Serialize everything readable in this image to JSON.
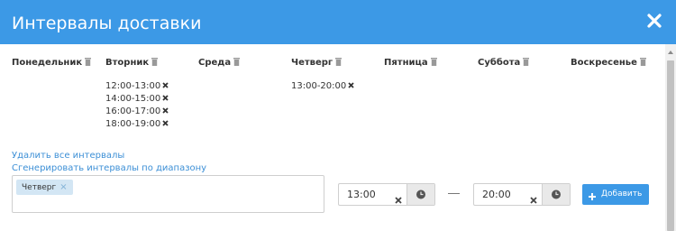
{
  "dialog": {
    "title": "Интервалы доставки",
    "close_icon": "close-icon"
  },
  "days": [
    {
      "name": "Понедельник",
      "slots": []
    },
    {
      "name": "Вторник",
      "slots": [
        "12:00-13:00",
        "14:00-15:00",
        "16:00-17:00",
        "18:00-19:00"
      ]
    },
    {
      "name": "Среда",
      "slots": []
    },
    {
      "name": "Четверг",
      "slots": [
        "13:00-20:00"
      ]
    },
    {
      "name": "Пятница",
      "slots": []
    },
    {
      "name": "Суббота",
      "slots": []
    },
    {
      "name": "Воскресенье",
      "slots": []
    }
  ],
  "actions": {
    "delete_all": "Удалить все интервалы",
    "generate": "Сгенерировать интервалы по диапазону"
  },
  "selected_days": [
    {
      "label": "Четверг"
    }
  ],
  "range": {
    "from": "13:00",
    "to": "20:00"
  },
  "add_button": {
    "label": "Добавить"
  },
  "colors": {
    "accent": "#3c99e6",
    "link": "#3c8fd6",
    "tag_bg": "#d3e6f4"
  }
}
